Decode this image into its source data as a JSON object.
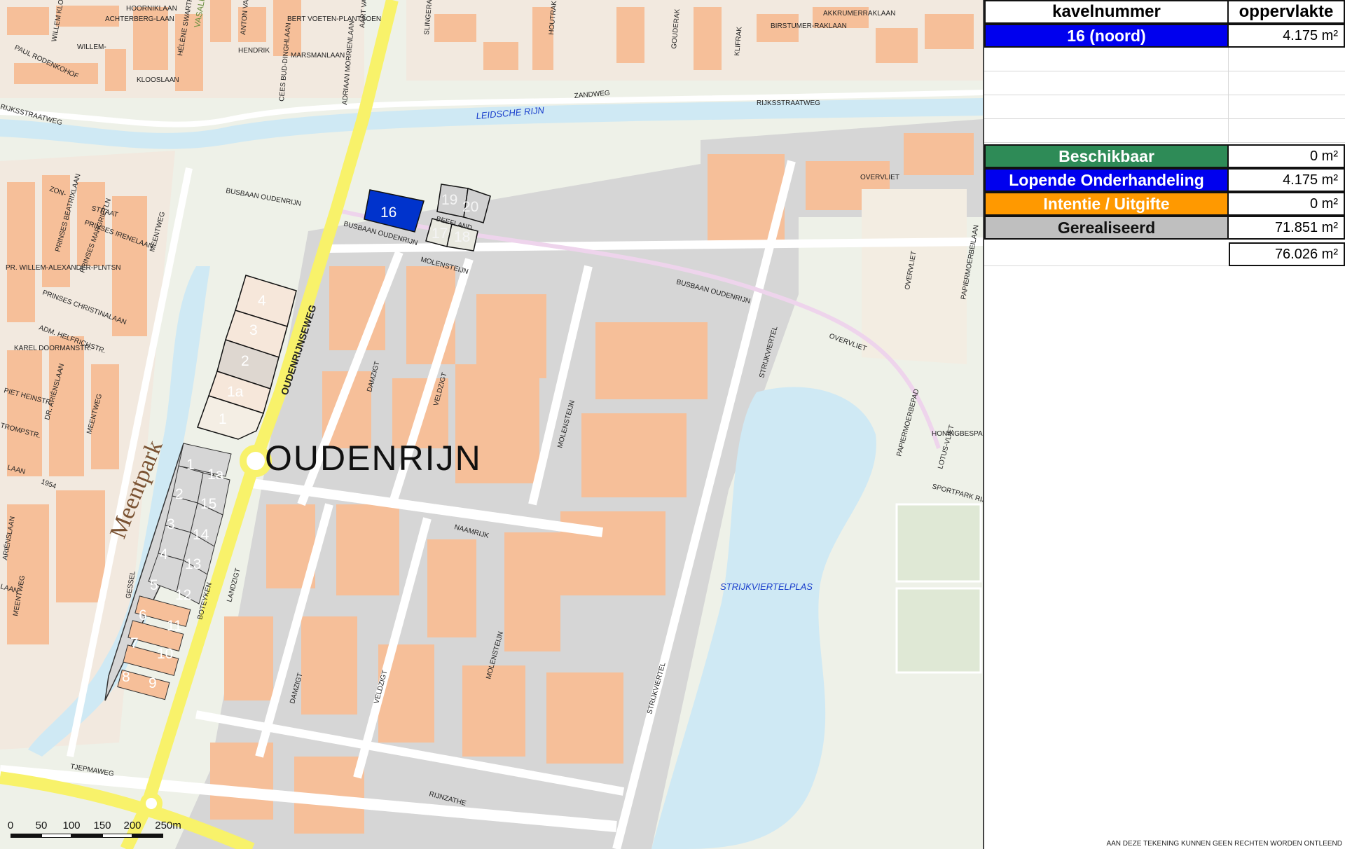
{
  "map": {
    "place_label": "OUDENRIJN",
    "park_label": "Meentpark",
    "colors": {
      "water": "#cfe9f4",
      "building": "#f6bf99",
      "industrial": "#d6d6d6",
      "green": "#e3ead8",
      "road": "#ffffff",
      "main_road": "#f8f26a",
      "available": "#2e8b57",
      "negotiation": "#0000ee",
      "intention": "#ff9900",
      "realised": "#bfbfbf"
    },
    "street_labels": [
      "HOORNIKLAAN",
      "ACHTERBERG-LAAN",
      "WILLEM KLOOS",
      "HÉLÈNE SWARTH",
      "VASALIS",
      "ANTON VAN",
      "AART VAN DE",
      "BERT VOETEN-PLANTSOEN",
      "HENDRIK",
      "MARSMANLAAN",
      "CEES BUD-DINGHLAAN",
      "ADRIAAN MORRIENLAAN",
      "PAUL RODENKOHOF",
      "WILLEM-",
      "KLOOSLAAN",
      "SLINGERAKLAAN",
      "HOUTRAK",
      "GOUDERAK",
      "KLIFRAK",
      "BIRSTUMER-RAKLAAN",
      "AKKRUMERRAKLAAN",
      "OUDENRIJNSEWEG",
      "ZANDWEG",
      "RIJKSSTRAATWEG",
      "RIJKSSTRAATWEG",
      "LEIDSCHE RIJN",
      "BUSBAAN OUDENRIJN",
      "BUSBAAN OUDENRIJN",
      "BUSBAAN OUDENRIJN",
      "BEEFLAND",
      "MOLENSTEIJN",
      "ZON-",
      "STRAAT",
      "PRINSES IRENELAAN",
      "PRINSES BEATRIXLAAN",
      "PRINSES MARGRIETLN",
      "PRINSES CHRISTINALAAN",
      "PR. WILLEM-ALEXANDER-PLNTSN",
      "ADM. HELFRICHSTR.",
      "KAREL DOORMANSTR.",
      "PIET HEINSTR.",
      "DR. ARIËNSLAAN",
      "MEENTWEG",
      "MEENTWEG",
      "MEENTWEG",
      "TROMPSTR.",
      "LAAN",
      "1954",
      "ARIËNSLAAN",
      "LAAN",
      "DAMZIGT",
      "VELDZIGT",
      "MOLENSTEIJN",
      "NAAMRIJK",
      "LANDZIGT",
      "DAMZIGT",
      "VELDZIGT",
      "MOLENSTEIJN",
      "STRIJKVIERTEL",
      "STRIJKVIERTEL",
      "STRIJKVIERTELPLAS",
      "OVERVLIET",
      "OVERVLIET",
      "OVERVLIET",
      "PAPIERMOERBEILAAN",
      "PAPIERMOERBEPAD",
      "HONINGBESPAD",
      "LOTUS-VLIET",
      "SPORTPARK RIJN",
      "GESSEL",
      "BOTEYKEN",
      "TJEPMAWEG",
      "RIJNZATHE"
    ],
    "lot_labels": [
      "16",
      "19",
      "20",
      "17",
      "18",
      "4",
      "3",
      "2",
      "1a",
      "1",
      "1",
      "1a",
      "2",
      "15",
      "3",
      "14",
      "4",
      "13",
      "5",
      "12",
      "6",
      "11",
      "7",
      "10",
      "8",
      "9"
    ],
    "scale_bar": {
      "labels": [
        "0",
        "50",
        "100",
        "150",
        "200",
        "250m"
      ]
    }
  },
  "table": {
    "header": {
      "name": "kavelnummer",
      "area": "oppervlakte"
    },
    "lots": [
      {
        "name": "16 (noord)",
        "area": "4.175 m²",
        "color": "#0000ee"
      }
    ],
    "empty_rows": 4,
    "legend": [
      {
        "name": "Beschikbaar",
        "area": "0 m²",
        "color": "#2e8b57",
        "text_color": "#ffffff"
      },
      {
        "name": "Lopende Onderhandeling",
        "area": "4.175 m²",
        "color": "#0000ee",
        "text_color": "#ffffff"
      },
      {
        "name": "Intentie / Uitgifte",
        "area": "0 m²",
        "color": "#ff9900",
        "text_color": "#ffffff"
      },
      {
        "name": "Gerealiseerd",
        "area": "71.851 m²",
        "color": "#bfbfbf",
        "text_color": "#111111"
      }
    ],
    "total": {
      "area": "76.026 m²"
    }
  },
  "disclaimer": "AAN DEZE TEKENING KUNNEN GEEN RECHTEN WORDEN ONTLEEND"
}
